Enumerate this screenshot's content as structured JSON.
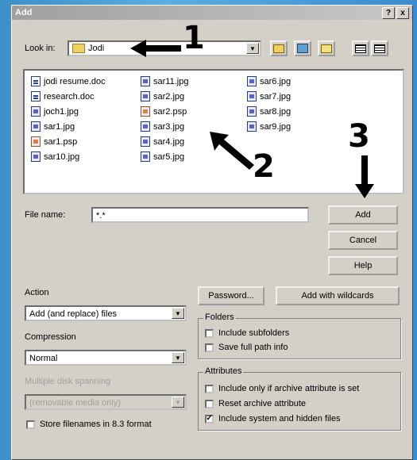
{
  "window": {
    "title": "Add",
    "help_btn": "?",
    "close_btn": "x"
  },
  "lookin": {
    "label": "Look in:",
    "value": "Jodi"
  },
  "files": {
    "col1": [
      "jodi resume.doc",
      "research.doc",
      "joch1.jpg",
      "sar1.jpg",
      "sar1.psp",
      "sar10.jpg"
    ],
    "col2": [
      "sar11.jpg",
      "sar2.jpg",
      "sar2.psp",
      "sar3.jpg",
      "sar4.jpg",
      "sar5.jpg"
    ],
    "col3": [
      "sar6.jpg",
      "sar7.jpg",
      "sar8.jpg",
      "sar9.jpg"
    ]
  },
  "filename": {
    "label": "File name:",
    "value": "*.*"
  },
  "buttons": {
    "add": "Add",
    "cancel": "Cancel",
    "help": "Help",
    "password": "Password...",
    "add_wildcards": "Add with wildcards"
  },
  "action": {
    "label": "Action",
    "value": "Add (and replace) files"
  },
  "compression": {
    "label": "Compression",
    "value": "Normal"
  },
  "multi": {
    "label": "Multiple disk spanning",
    "value": "(removable media only)"
  },
  "store_83": "Store filenames in 8.3 format",
  "folders": {
    "title": "Folders",
    "include_sub": "Include subfolders",
    "save_path": "Save full path info"
  },
  "attributes": {
    "title": "Attributes",
    "archive_only": "Include only if archive attribute is set",
    "reset_archive": "Reset archive attribute",
    "include_system": "Include system and hidden files"
  },
  "annotations": {
    "one": "1",
    "two": "2",
    "three": "3"
  }
}
